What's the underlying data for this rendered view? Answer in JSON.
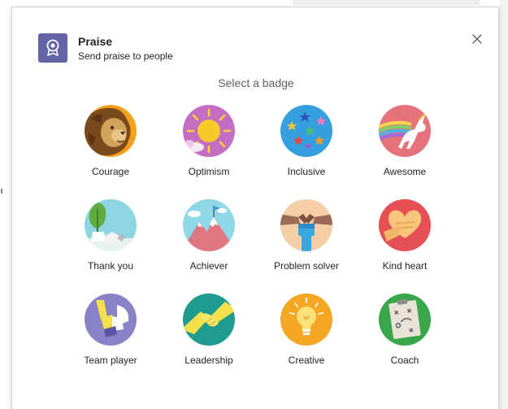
{
  "dialog": {
    "title": "Praise",
    "subtitle": "Send praise to people",
    "section_label": "Select a badge",
    "accent_color": "#6264a7",
    "header_icon": "award-ribbon-icon",
    "close_icon": "close-icon"
  },
  "badges": [
    {
      "label": "Courage",
      "icon": "lion-icon"
    },
    {
      "label": "Optimism",
      "icon": "sun-icon"
    },
    {
      "label": "Inclusive",
      "icon": "stars-icon"
    },
    {
      "label": "Awesome",
      "icon": "unicorn-icon"
    },
    {
      "label": "Thank you",
      "icon": "plant-icon"
    },
    {
      "label": "Achiever",
      "icon": "mountain-flag-icon"
    },
    {
      "label": "Problem solver",
      "icon": "fist-icon"
    },
    {
      "label": "Kind heart",
      "icon": "heart-hands-icon"
    },
    {
      "label": "Team player",
      "icon": "team-hands-icon"
    },
    {
      "label": "Leadership",
      "icon": "handshake-icon"
    },
    {
      "label": "Creative",
      "icon": "lightbulb-icon"
    },
    {
      "label": "Coach",
      "icon": "clipboard-icon"
    }
  ]
}
